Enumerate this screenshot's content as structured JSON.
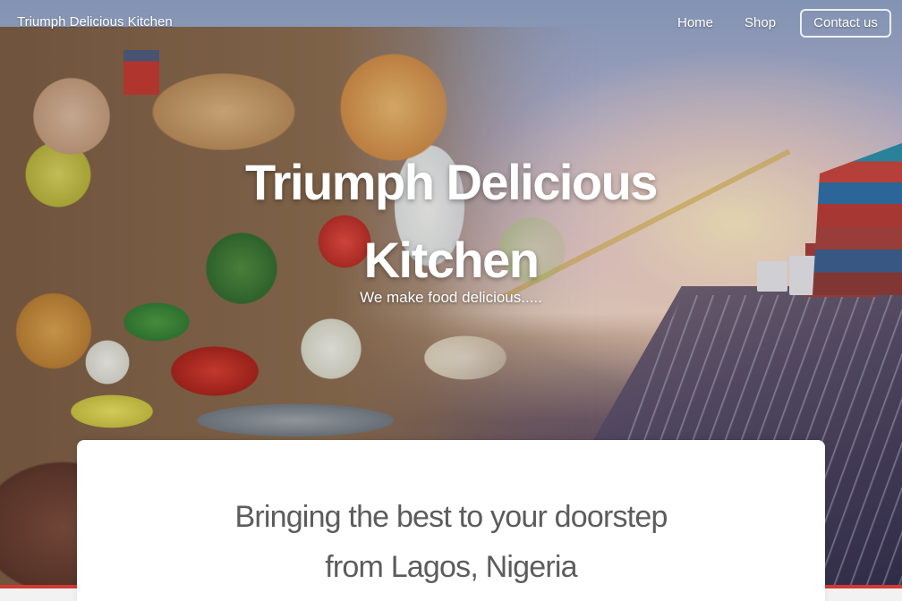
{
  "navbar": {
    "brand": "Triumph Delicious Kitchen",
    "links": [
      {
        "label": "Home"
      },
      {
        "label": "Shop"
      }
    ],
    "contact_label": "Contact us"
  },
  "hero": {
    "title_line1": "Triumph Delicious",
    "title_line2": "Kitchen",
    "subtitle": "We make food delicious....."
  },
  "main": {
    "heading_line1": "Bringing the best to your doorstep",
    "heading_line2": "from Lagos, Nigeria"
  },
  "colors": {
    "nav_text": "#ffffff",
    "heading_text": "#5c5c5c",
    "accent_band": "#d33a33",
    "card_bg": "#ffffff"
  }
}
